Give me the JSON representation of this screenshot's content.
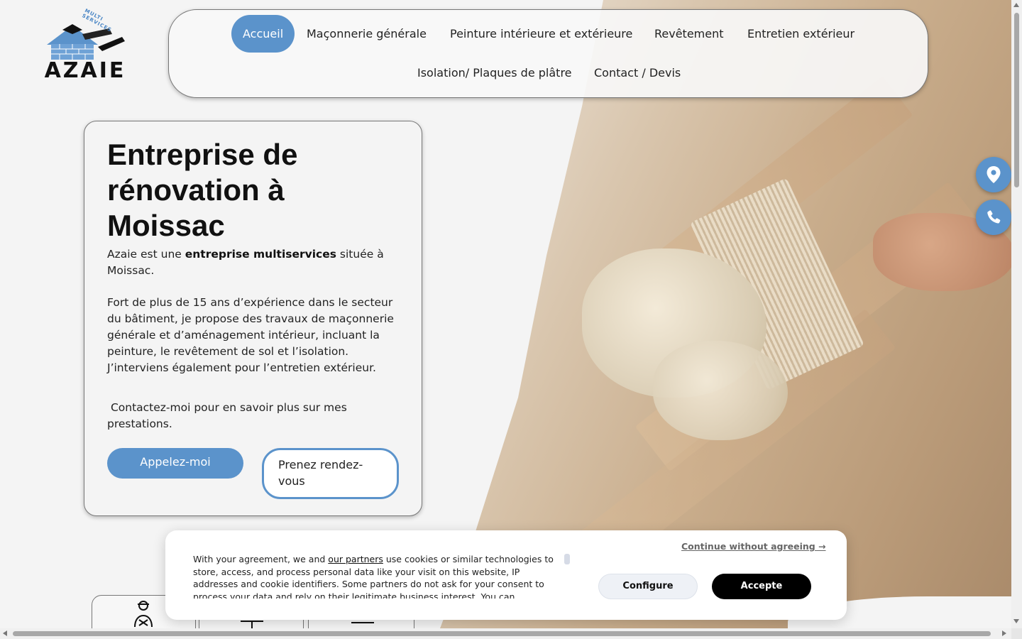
{
  "logo": {
    "name": "AZAIE",
    "tagline": "MULTI SERVICES"
  },
  "nav": {
    "items": [
      {
        "label": "Accueil",
        "active": true
      },
      {
        "label": "Maçonnerie générale"
      },
      {
        "label": "Peinture intérieure et extérieure"
      },
      {
        "label": "Revêtement"
      },
      {
        "label": "Entretien extérieur"
      },
      {
        "label": "Isolation/ Plaques de plâtre"
      },
      {
        "label": "Contact / Devis"
      }
    ]
  },
  "hero": {
    "title": "Entreprise de rénovation à Moissac",
    "intro_before": "Azaie est une ",
    "intro_bold": "entreprise multiservices",
    "intro_after": " située à Moissac.",
    "paragraph2": "Fort de plus de 15 ans d’expérience dans le secteur du bâtiment, je propose des travaux de maçonnerie générale et d’aménagement intérieur, incluant la peinture, le revêtement de sol et l’isolation. J’interviens également pour l’entretien extérieur.",
    "paragraph3": " Contactez-moi pour en savoir plus sur mes prestations.",
    "call_button": "Appelez-moi",
    "rdv_button": "Prenez rendez-vous"
  },
  "floating": {
    "location_icon": "map-pin-icon",
    "phone_icon": "phone-icon"
  },
  "cookie": {
    "text_before": "With your agreement, we and ",
    "partners_link": "our partners",
    "text_after": " use cookies or similar technologies to store, access, and process personal data like your visit on this website, IP addresses and cookie identifiers. Some partners do not ask for your consent to process your data and rely on their legitimate business interest. You can",
    "continue_label": "Continue without agreeing →",
    "configure_label": "Configure",
    "accept_label": "Accepte"
  },
  "colors": {
    "accent": "#5b93cb",
    "dark": "#111111",
    "background": "#f4f4f4"
  }
}
